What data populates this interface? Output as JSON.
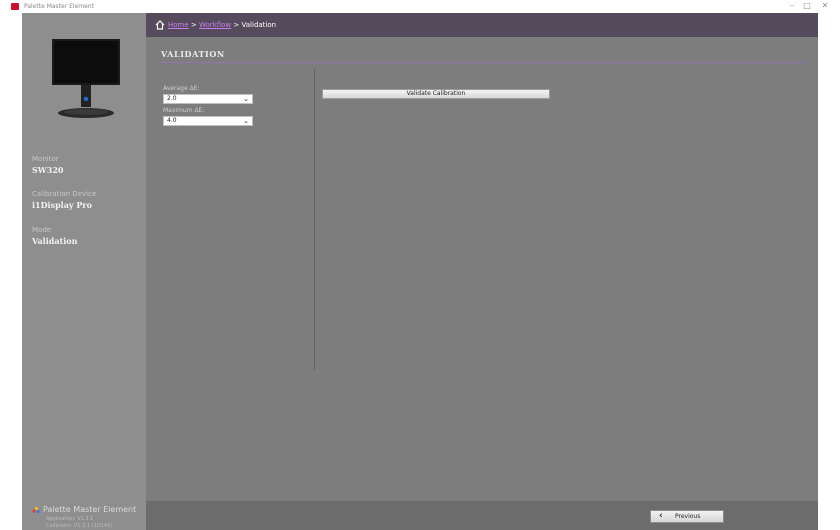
{
  "window": {
    "title": "Palette Master Element",
    "minimize_label": "–",
    "maximize_label": "□",
    "close_label": "✕"
  },
  "sidebar": {
    "monitor": {
      "label": "Monitor",
      "value": "SW320"
    },
    "device": {
      "label": "Calibration Device",
      "value": "i1Display Pro"
    },
    "mode": {
      "label": "Mode",
      "value": "Validation"
    },
    "brand": {
      "name": "Palette Master Element",
      "application_version": "Application: V1.3.1",
      "calibrator_version": "Calibrator: V1.3.1 (1D148)"
    }
  },
  "breadcrumb": {
    "home": "Home",
    "separator": ">",
    "workflow": "Workflow",
    "current": "Validation"
  },
  "main": {
    "title": "VALIDATION",
    "average_label": "Average ΔE:",
    "average_value": "2.0",
    "maximum_label": "Maximum ΔE:",
    "maximum_value": "4.0",
    "validate_button": "Validate Calibration"
  },
  "footer": {
    "previous_label": "Previous"
  },
  "colors": {
    "accent": "#9b6fb5",
    "link": "#c77ef0",
    "breadcrumb_bar": "#564b5c",
    "brand_red": "#c8102e"
  }
}
